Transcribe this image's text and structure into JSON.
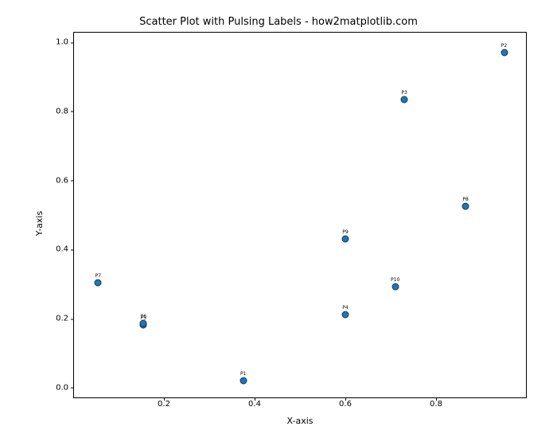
{
  "chart_data": {
    "type": "scatter",
    "title": "Scatter Plot with Pulsing Labels - how2matplotlib.com",
    "xlabel": "X-axis",
    "ylabel": "Y-axis",
    "xlim": [
      0.0,
      1.0
    ],
    "ylim": [
      -0.03,
      1.03
    ],
    "xticks": [
      0.2,
      0.4,
      0.6,
      0.8
    ],
    "yticks": [
      0.0,
      0.2,
      0.4,
      0.6,
      0.8,
      1.0
    ],
    "series": [
      {
        "name": "points",
        "points": [
          {
            "label": "P1",
            "x": 0.375,
            "y": 0.02
          },
          {
            "label": "P2",
            "x": 0.95,
            "y": 0.97
          },
          {
            "label": "P3",
            "x": 0.73,
            "y": 0.833
          },
          {
            "label": "P4",
            "x": 0.6,
            "y": 0.212
          },
          {
            "label": "P5",
            "x": 0.155,
            "y": 0.182
          },
          {
            "label": "P6",
            "x": 0.155,
            "y": 0.186
          },
          {
            "label": "P7",
            "x": 0.055,
            "y": 0.305
          },
          {
            "label": "P8",
            "x": 0.865,
            "y": 0.525
          },
          {
            "label": "P9",
            "x": 0.6,
            "y": 0.432
          },
          {
            "label": "P10",
            "x": 0.71,
            "y": 0.292
          }
        ]
      }
    ]
  }
}
